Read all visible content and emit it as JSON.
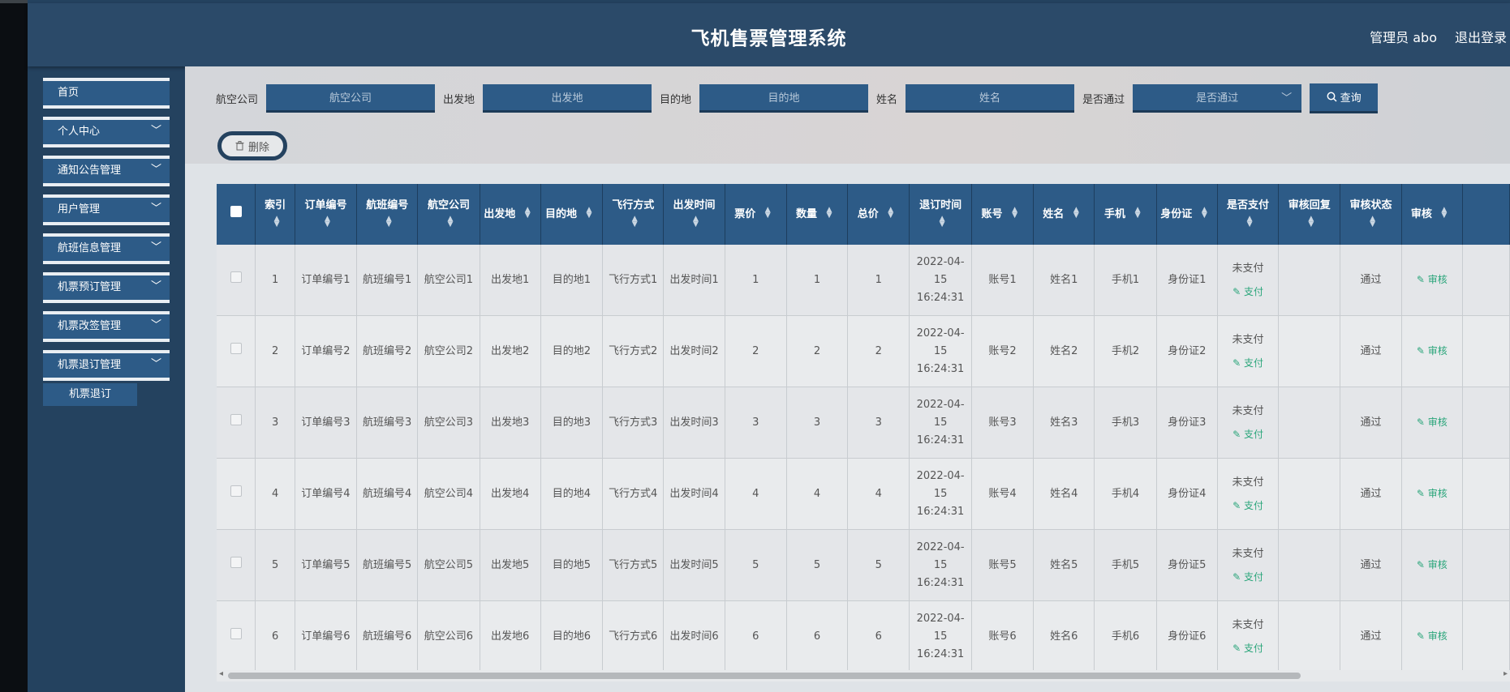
{
  "header": {
    "title": "飞机售票管理系统",
    "user": "管理员 abo",
    "logout": "退出登录"
  },
  "sidebar": {
    "items": [
      {
        "label": "首页",
        "chevron": false
      },
      {
        "label": "个人中心",
        "chevron": true
      },
      {
        "label": "通知公告管理",
        "chevron": true
      },
      {
        "label": "用户管理",
        "chevron": true
      },
      {
        "label": "航班信息管理",
        "chevron": true
      },
      {
        "label": "机票预订管理",
        "chevron": true
      },
      {
        "label": "机票改签管理",
        "chevron": true
      },
      {
        "label": "机票退订管理",
        "chevron": true
      }
    ],
    "submenu": "机票退订"
  },
  "filters": {
    "airline_label": "航空公司",
    "airline_placeholder": "航空公司",
    "from_label": "出发地",
    "from_placeholder": "出发地",
    "to_label": "目的地",
    "to_placeholder": "目的地",
    "name_label": "姓名",
    "name_placeholder": "姓名",
    "passed_label": "是否通过",
    "passed_placeholder": "是否通过",
    "search": "查询"
  },
  "actions": {
    "delete": "删除"
  },
  "table": {
    "columns": [
      "索引",
      "订单编号",
      "航班编号",
      "航空公司",
      "出发地",
      "目的地",
      "飞行方式",
      "出发时间",
      "票价",
      "数量",
      "总价",
      "退订时间",
      "账号",
      "姓名",
      "手机",
      "身份证",
      "是否支付",
      "审核回复",
      "审核状态",
      "审核"
    ],
    "rows": [
      [
        "1",
        "订单编号1",
        "航班编号1",
        "航空公司1",
        "出发地1",
        "目的地1",
        "飞行方式1",
        "出发时间1",
        "1",
        "1",
        "1",
        "2022-04-15 16:24:31",
        "账号1",
        "姓名1",
        "手机1",
        "身份证1",
        "未支付",
        "",
        "通过"
      ],
      [
        "2",
        "订单编号2",
        "航班编号2",
        "航空公司2",
        "出发地2",
        "目的地2",
        "飞行方式2",
        "出发时间2",
        "2",
        "2",
        "2",
        "2022-04-15 16:24:31",
        "账号2",
        "姓名2",
        "手机2",
        "身份证2",
        "未支付",
        "",
        "通过"
      ],
      [
        "3",
        "订单编号3",
        "航班编号3",
        "航空公司3",
        "出发地3",
        "目的地3",
        "飞行方式3",
        "出发时间3",
        "3",
        "3",
        "3",
        "2022-04-15 16:24:31",
        "账号3",
        "姓名3",
        "手机3",
        "身份证3",
        "未支付",
        "",
        "通过"
      ],
      [
        "4",
        "订单编号4",
        "航班编号4",
        "航空公司4",
        "出发地4",
        "目的地4",
        "飞行方式4",
        "出发时间4",
        "4",
        "4",
        "4",
        "2022-04-15 16:24:31",
        "账号4",
        "姓名4",
        "手机4",
        "身份证4",
        "未支付",
        "",
        "通过"
      ],
      [
        "5",
        "订单编号5",
        "航班编号5",
        "航空公司5",
        "出发地5",
        "目的地5",
        "飞行方式5",
        "出发时间5",
        "5",
        "5",
        "5",
        "2022-04-15 16:24:31",
        "账号5",
        "姓名5",
        "手机5",
        "身份证5",
        "未支付",
        "",
        "通过"
      ],
      [
        "6",
        "订单编号6",
        "航班编号6",
        "航空公司6",
        "出发地6",
        "目的地6",
        "飞行方式6",
        "出发时间6",
        "6",
        "6",
        "6",
        "2022-04-15 16:24:31",
        "账号6",
        "姓名6",
        "手机6",
        "身份证6",
        "未支付",
        "",
        "通过"
      ]
    ],
    "pay_link": "支付",
    "audit_link": "审核"
  },
  "colors": {
    "primary": "#2d5b87",
    "header": "#2b4a69",
    "link": "#2aa57a"
  }
}
